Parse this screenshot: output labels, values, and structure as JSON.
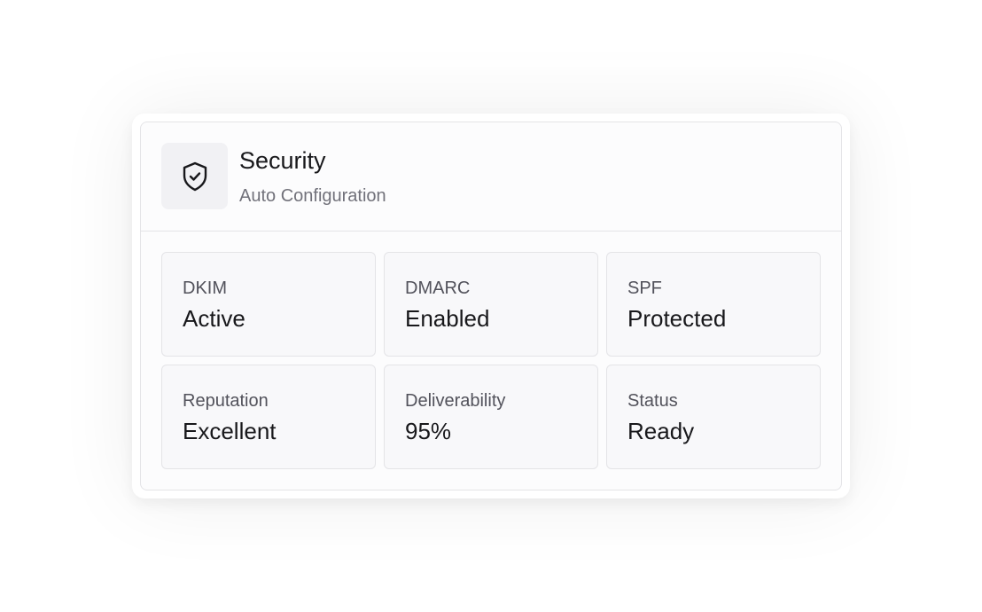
{
  "header": {
    "icon": "shield-check-icon",
    "title": "Security",
    "subtitle": "Auto Configuration"
  },
  "tiles": [
    {
      "label": "DKIM",
      "value": "Active"
    },
    {
      "label": "DMARC",
      "value": "Enabled"
    },
    {
      "label": "SPF",
      "value": "Protected"
    },
    {
      "label": "Reputation",
      "value": "Excellent"
    },
    {
      "label": "Deliverability",
      "value": "95%"
    },
    {
      "label": "Status",
      "value": "Ready"
    }
  ]
}
